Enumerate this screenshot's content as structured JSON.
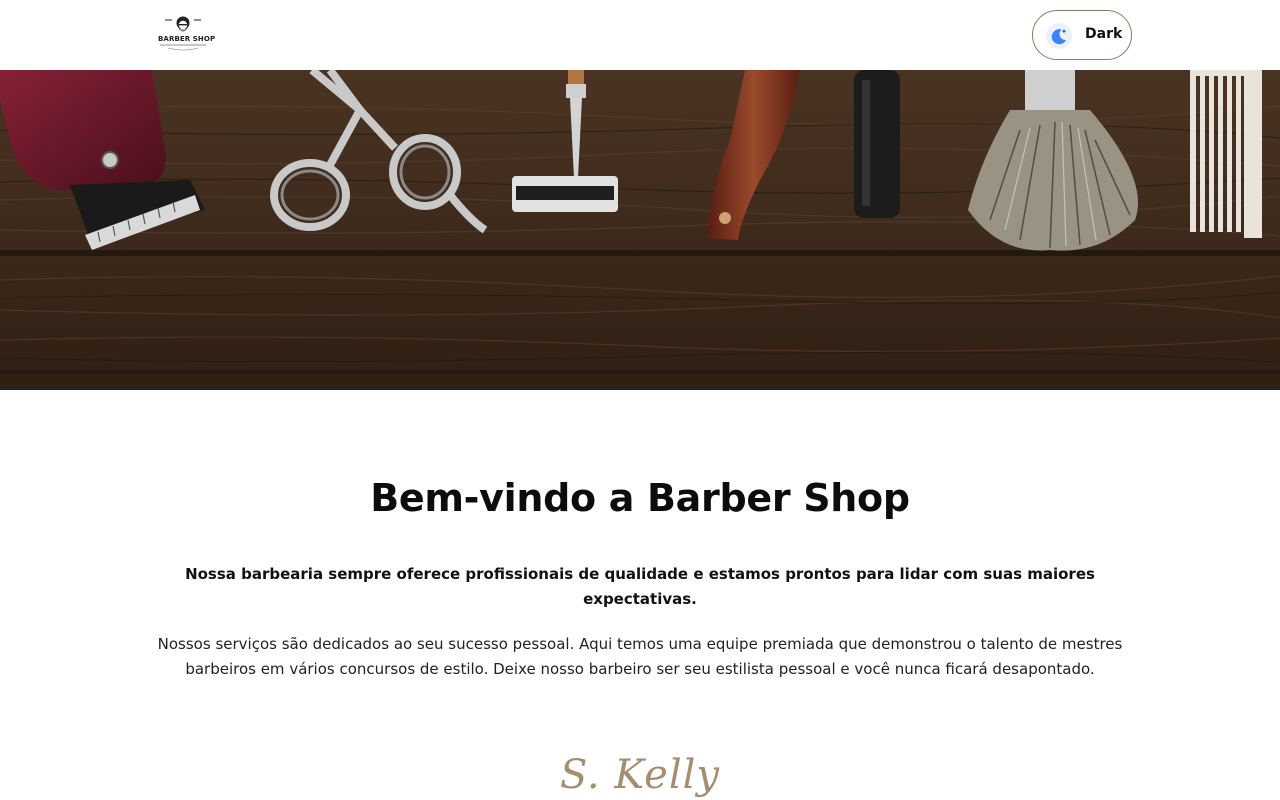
{
  "header": {
    "logo_text": "BARBER SHOP",
    "theme_toggle": {
      "label": "Dark",
      "icon": "moon-icon"
    }
  },
  "hero": {
    "image": "barber-tools-on-wood",
    "tools": [
      "hair-clipper",
      "scissors",
      "safety-razor",
      "straight-razor",
      "shaving-brush",
      "comb"
    ]
  },
  "main": {
    "title": "Bem-vindo a Barber Shop",
    "lead": "Nossa barbearia sempre oferece profissionais de qualidade e estamos prontos para lidar com suas maiores expectativas.",
    "description": "Nossos serviços são dedicados ao seu sucesso pessoal. Aqui temos uma equipe premiada que demonstrou o talento de mestres barbeiros em vários concursos de estilo. Deixe nosso barbeiro ser seu estilista pessoal e você nunca ficará desapontado.",
    "signature": "S. Kelly"
  },
  "colors": {
    "accent": "#a58e6f",
    "button_border": "#8f7a5f",
    "moon": "#3b82f6"
  }
}
